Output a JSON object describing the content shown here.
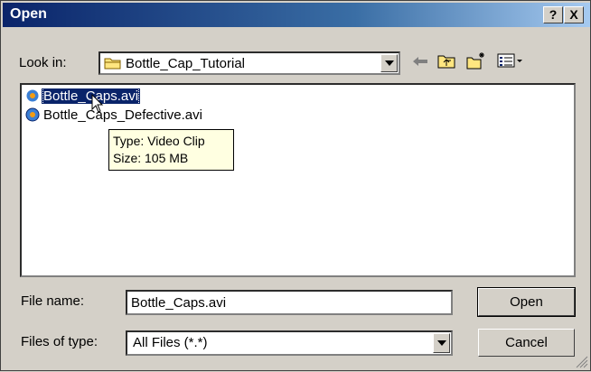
{
  "window": {
    "title": "Open",
    "help_label": "?",
    "close_label": "X"
  },
  "look_in": {
    "label": "Look in:",
    "value": "Bottle_Cap_Tutorial"
  },
  "files": [
    {
      "name": "Bottle_Caps.avi",
      "selected": true
    },
    {
      "name": "Bottle_Caps_Defective.avi",
      "selected": false
    }
  ],
  "tooltip": {
    "type_line": "Type: Video Clip",
    "size_line": "Size: 105 MB"
  },
  "file_name": {
    "label": "File name:",
    "value": "Bottle_Caps.avi"
  },
  "file_type": {
    "label": "Files of type:",
    "value": "All Files (*.*)"
  },
  "buttons": {
    "open": "Open",
    "cancel": "Cancel"
  },
  "colors": {
    "title_bar": "#0a246a",
    "selection": "#0a246a",
    "tooltip_bg": "#ffffe1",
    "face": "#d4d0c8"
  }
}
